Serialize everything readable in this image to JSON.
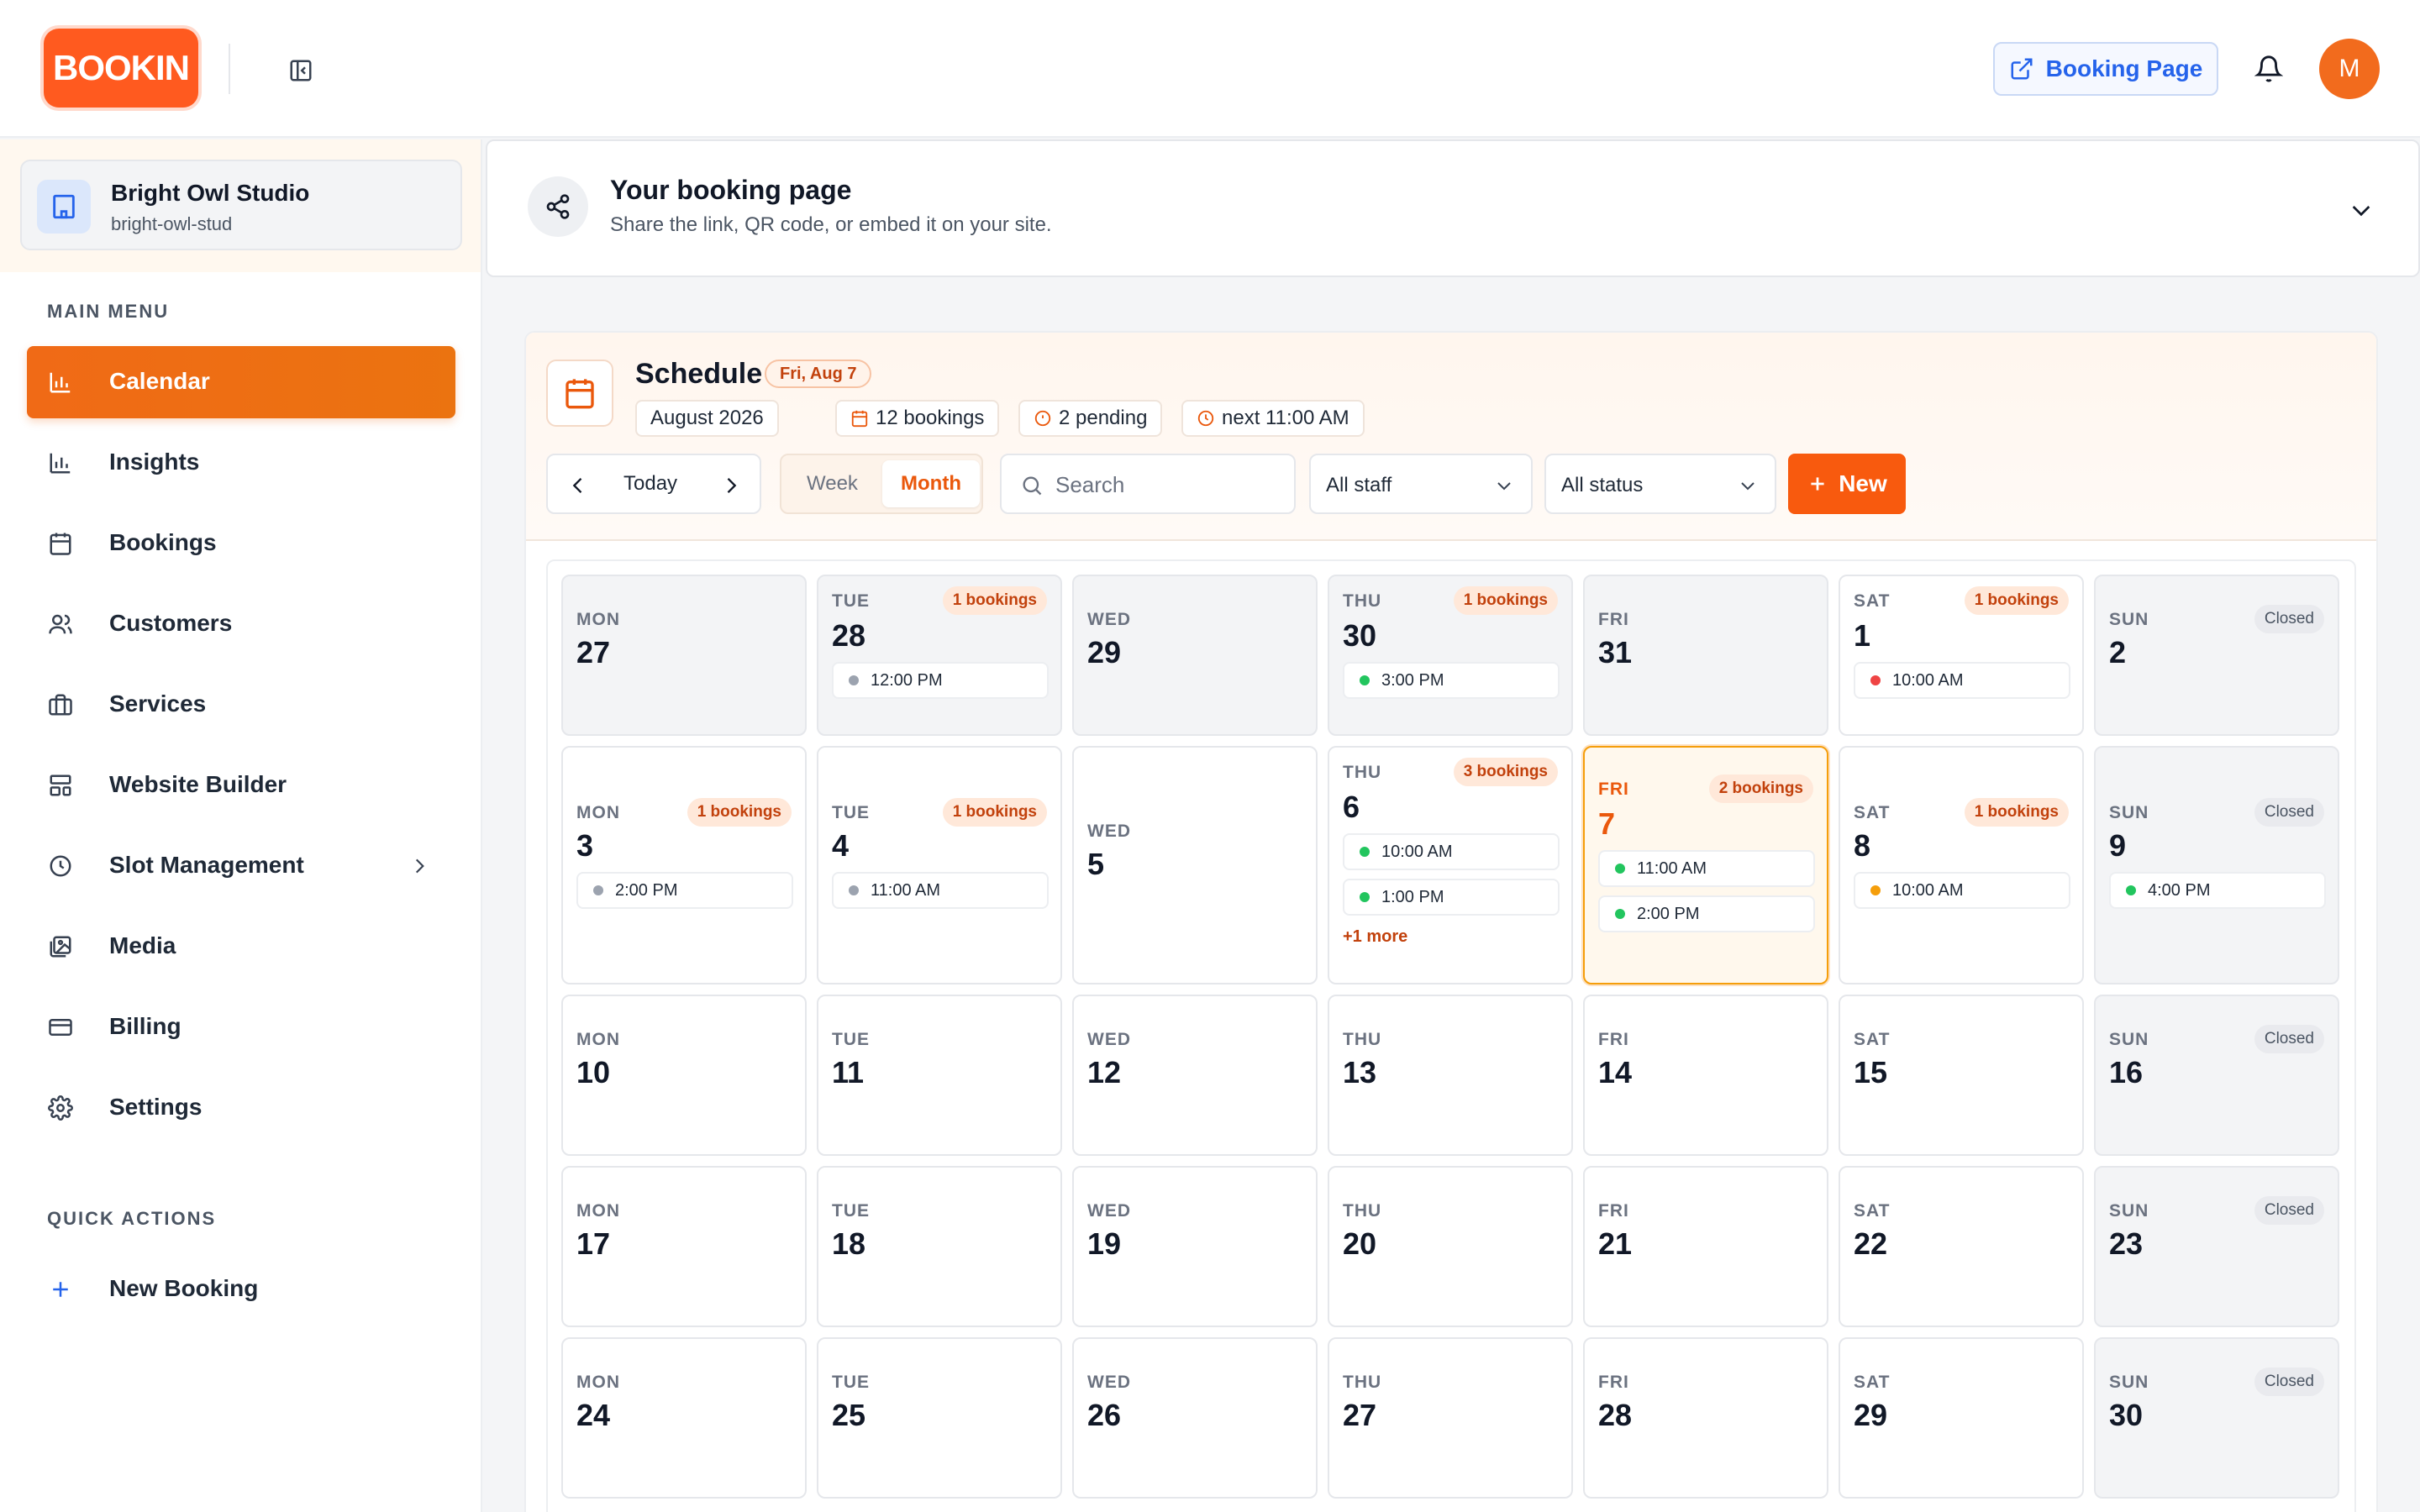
{
  "header": {
    "logo_text": "BOOKIN",
    "booking_page_label": "Booking Page",
    "avatar_initial": "M"
  },
  "sidebar": {
    "workspace": {
      "name": "Bright Owl Studio",
      "slug": "bright-owl-stud"
    },
    "main_menu_label": "MAIN MENU",
    "items": [
      {
        "label": "Calendar",
        "icon": "chart-icon"
      },
      {
        "label": "Insights",
        "icon": "bar-chart-icon"
      },
      {
        "label": "Bookings",
        "icon": "calendar-icon"
      },
      {
        "label": "Customers",
        "icon": "users-icon"
      },
      {
        "label": "Services",
        "icon": "briefcase-icon"
      },
      {
        "label": "Website Builder",
        "icon": "layout-icon"
      },
      {
        "label": "Slot Management",
        "icon": "clock-icon"
      },
      {
        "label": "Media",
        "icon": "image-icon"
      },
      {
        "label": "Billing",
        "icon": "credit-card-icon"
      },
      {
        "label": "Settings",
        "icon": "gear-icon"
      }
    ],
    "quick_actions_label": "QUICK ACTIONS",
    "new_booking_label": "New Booking"
  },
  "booking_page_card": {
    "title": "Your booking page",
    "subtitle": "Share the link, QR code, or embed it on your site."
  },
  "schedule": {
    "title": "Schedule",
    "date_pill": "Fri, Aug 7",
    "chips": {
      "month": "August 2026",
      "bookings": "12 bookings",
      "pending": "2 pending",
      "next": "next 11:00 AM"
    },
    "today_label": "Today",
    "view_week": "Week",
    "view_month": "Month",
    "search_placeholder": "Search",
    "staff_filter": "All staff",
    "status_filter": "All status",
    "new_label": "New"
  },
  "colors": {
    "accent": "#f85a0e",
    "status_green": "#22c55e",
    "status_red": "#ef4444",
    "status_amber": "#f59e0b",
    "status_gray": "#9ca3af"
  },
  "calendar": {
    "weeks": [
      [
        {
          "dow": "MON",
          "day": "27",
          "muted": true,
          "badge": "",
          "events": []
        },
        {
          "dow": "TUE",
          "day": "28",
          "muted": true,
          "badge": "1 bookings",
          "events": [
            {
              "time": "12:00 PM",
              "color": "#9ca3af"
            }
          ]
        },
        {
          "dow": "WED",
          "day": "29",
          "muted": true,
          "badge": "",
          "events": []
        },
        {
          "dow": "THU",
          "day": "30",
          "muted": true,
          "badge": "1 bookings",
          "events": [
            {
              "time": "3:00 PM",
              "color": "#22c55e"
            }
          ]
        },
        {
          "dow": "FRI",
          "day": "31",
          "muted": true,
          "badge": "",
          "events": []
        },
        {
          "dow": "SAT",
          "day": "1",
          "muted": false,
          "badge": "1 bookings",
          "events": [
            {
              "time": "10:00 AM",
              "color": "#ef4444"
            }
          ]
        },
        {
          "dow": "SUN",
          "day": "2",
          "muted": true,
          "badge": "Closed",
          "events": []
        }
      ],
      [
        {
          "dow": "MON",
          "day": "3",
          "muted": false,
          "badge": "1 bookings",
          "events": [
            {
              "time": "2:00 PM",
              "color": "#9ca3af"
            }
          ]
        },
        {
          "dow": "TUE",
          "day": "4",
          "muted": false,
          "badge": "1 bookings",
          "events": [
            {
              "time": "11:00 AM",
              "color": "#9ca3af"
            }
          ]
        },
        {
          "dow": "WED",
          "day": "5",
          "muted": false,
          "badge": "",
          "events": []
        },
        {
          "dow": "THU",
          "day": "6",
          "muted": false,
          "badge": "3 bookings",
          "events": [
            {
              "time": "10:00 AM",
              "color": "#22c55e"
            },
            {
              "time": "1:00 PM",
              "color": "#22c55e"
            }
          ],
          "more": "+1 more"
        },
        {
          "dow": "FRI",
          "day": "7",
          "muted": false,
          "today": true,
          "badge": "2 bookings",
          "events": [
            {
              "time": "11:00 AM",
              "color": "#22c55e"
            },
            {
              "time": "2:00 PM",
              "color": "#22c55e"
            }
          ]
        },
        {
          "dow": "SAT",
          "day": "8",
          "muted": false,
          "badge": "1 bookings",
          "events": [
            {
              "time": "10:00 AM",
              "color": "#f59e0b"
            }
          ]
        },
        {
          "dow": "SUN",
          "day": "9",
          "muted": true,
          "badge": "Closed",
          "events": [
            {
              "time": "4:00 PM",
              "color": "#22c55e"
            }
          ]
        }
      ],
      [
        {
          "dow": "MON",
          "day": "10",
          "muted": false,
          "badge": "",
          "events": []
        },
        {
          "dow": "TUE",
          "day": "11",
          "muted": false,
          "badge": "",
          "events": []
        },
        {
          "dow": "WED",
          "day": "12",
          "muted": false,
          "badge": "",
          "events": []
        },
        {
          "dow": "THU",
          "day": "13",
          "muted": false,
          "badge": "",
          "events": []
        },
        {
          "dow": "FRI",
          "day": "14",
          "muted": false,
          "badge": "",
          "events": []
        },
        {
          "dow": "SAT",
          "day": "15",
          "muted": false,
          "badge": "",
          "events": []
        },
        {
          "dow": "SUN",
          "day": "16",
          "muted": true,
          "badge": "Closed",
          "events": []
        }
      ],
      [
        {
          "dow": "MON",
          "day": "17",
          "muted": false,
          "badge": "",
          "events": []
        },
        {
          "dow": "TUE",
          "day": "18",
          "muted": false,
          "badge": "",
          "events": []
        },
        {
          "dow": "WED",
          "day": "19",
          "muted": false,
          "badge": "",
          "events": []
        },
        {
          "dow": "THU",
          "day": "20",
          "muted": false,
          "badge": "",
          "events": []
        },
        {
          "dow": "FRI",
          "day": "21",
          "muted": false,
          "badge": "",
          "events": []
        },
        {
          "dow": "SAT",
          "day": "22",
          "muted": false,
          "badge": "",
          "events": []
        },
        {
          "dow": "SUN",
          "day": "23",
          "muted": true,
          "badge": "Closed",
          "events": []
        }
      ],
      [
        {
          "dow": "MON",
          "day": "24",
          "muted": false,
          "badge": "",
          "events": []
        },
        {
          "dow": "TUE",
          "day": "25",
          "muted": false,
          "badge": "",
          "events": []
        },
        {
          "dow": "WED",
          "day": "26",
          "muted": false,
          "badge": "",
          "events": []
        },
        {
          "dow": "THU",
          "day": "27",
          "muted": false,
          "badge": "",
          "events": []
        },
        {
          "dow": "FRI",
          "day": "28",
          "muted": false,
          "badge": "",
          "events": []
        },
        {
          "dow": "SAT",
          "day": "29",
          "muted": false,
          "badge": "",
          "events": []
        },
        {
          "dow": "SUN",
          "day": "30",
          "muted": true,
          "badge": "Closed",
          "events": []
        }
      ]
    ]
  }
}
